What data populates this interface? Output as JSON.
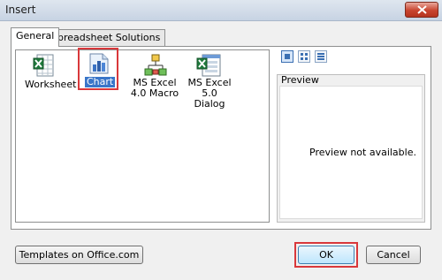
{
  "window": {
    "title": "Insert"
  },
  "tabs": [
    {
      "label": "General",
      "active": true
    },
    {
      "label": "Spreadsheet Solutions",
      "active": false
    }
  ],
  "items": [
    {
      "label": "Worksheet",
      "icon": "worksheet-icon"
    },
    {
      "label": "Chart",
      "icon": "chart-icon",
      "selected": true
    },
    {
      "label": "MS Excel 4.0 Macro",
      "icon": "macro-icon"
    },
    {
      "label": "MS Excel 5.0 Dialog",
      "icon": "dialog-icon"
    }
  ],
  "view_buttons": [
    "large-icons-view",
    "list-view",
    "details-view"
  ],
  "preview": {
    "label": "Preview",
    "message": "Preview not available."
  },
  "buttons": {
    "templates": "Templates on Office.com",
    "ok": "OK",
    "cancel": "Cancel"
  },
  "colors": {
    "highlight": "#d9383b",
    "selection": "#3a76c9"
  }
}
